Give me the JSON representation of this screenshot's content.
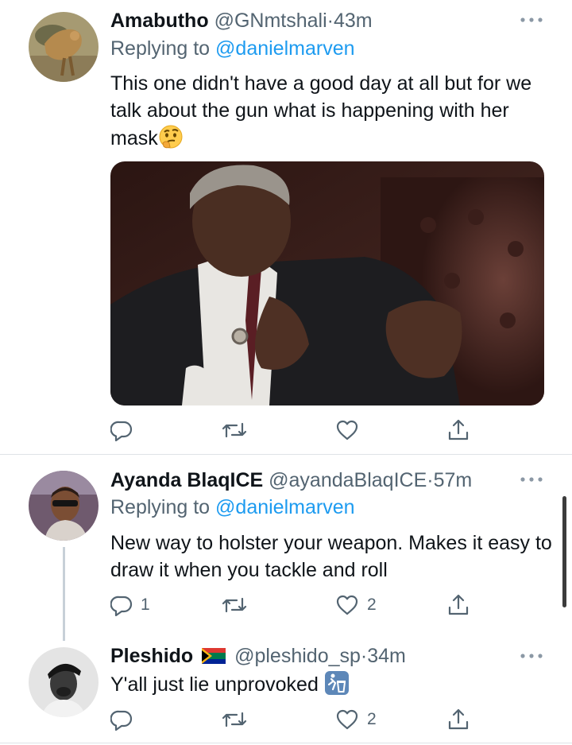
{
  "tweets": [
    {
      "display_name": "Amabutho",
      "handle": "@GNmtshali",
      "separator": "·",
      "time": "43m",
      "replying_prefix": "Replying to",
      "replying_to": "@danielmarven",
      "text": "This one didn't have a good day at all but for we talk about the gun what is happening with her mask",
      "emoji": "thinking-face-icon",
      "counts": {
        "reply": "",
        "retweet": "",
        "like": ""
      }
    },
    {
      "display_name": "Ayanda BlaqICE",
      "handle": "@ayandaBlaqICE",
      "separator": "·",
      "time": "57m",
      "replying_prefix": "Replying to",
      "replying_to": "@danielmarven",
      "text": "New way to holster your weapon. Makes it easy to draw it when you tackle and roll",
      "counts": {
        "reply": "1",
        "retweet": "",
        "like": "2"
      }
    },
    {
      "display_name": "Pleshido",
      "flag": "south-africa-flag-icon",
      "handle": "@pleshido_sp",
      "separator": "·",
      "time": "34m",
      "text": "Y'all just lie unprovoked",
      "emoji": "wastebasket-icon",
      "counts": {
        "reply": "",
        "retweet": "",
        "like": "2"
      }
    }
  ],
  "icons": {
    "reply": "reply-icon",
    "retweet": "retweet-icon",
    "like": "heart-icon",
    "share": "share-icon",
    "more": "more-options-icon"
  },
  "colors": {
    "text": "#0f1419",
    "secondary": "#536471",
    "link": "#1d9bf0",
    "divider": "#dfe3e7"
  }
}
